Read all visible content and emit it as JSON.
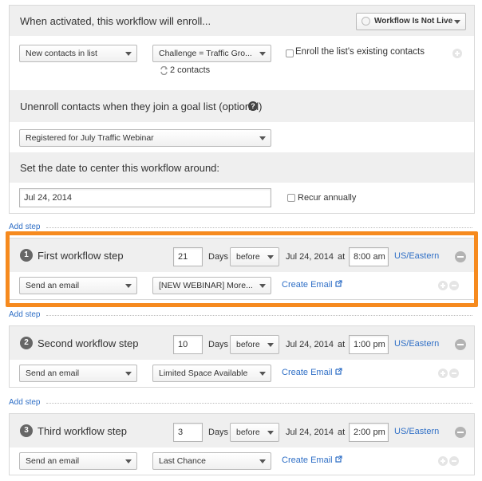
{
  "enroll": {
    "title": "When activated, this workflow will enroll...",
    "status_button": "Workflow Is Not Live",
    "list_type_select": "New contacts in list",
    "list_select": "Challenge = Traffic Gro...",
    "enroll_existing_label": "Enroll the list's existing contacts",
    "contacts_count": "2 contacts"
  },
  "unenroll": {
    "title": "Unenroll contacts when they join a goal list (optional)",
    "goal_list_select": "Registered for July Traffic Webinar"
  },
  "center_date": {
    "title": "Set the date to center this workflow around:",
    "date_value": "Jul 24, 2014",
    "recur_label": "Recur annually"
  },
  "add_step_label": "Add step",
  "common": {
    "days_label": "Days",
    "at_label": "at",
    "timezone": "US/Eastern",
    "create_email": "Create Email",
    "action": "Send an email"
  },
  "steps": [
    {
      "number": "1",
      "title": "First workflow step",
      "days": "21",
      "relation": "before",
      "date": "Jul 24, 2014",
      "time": "8:00 am",
      "email": "[NEW WEBINAR] More..."
    },
    {
      "number": "2",
      "title": "Second workflow step",
      "days": "10",
      "relation": "before",
      "date": "Jul 24, 2014",
      "time": "1:00 pm",
      "email": "Limited Space Available"
    },
    {
      "number": "3",
      "title": "Third workflow step",
      "days": "3",
      "relation": "before",
      "date": "Jul 24, 2014",
      "time": "2:00 pm",
      "email": "Last Chance"
    }
  ],
  "colors": {
    "highlight": "#f68a1e",
    "link": "#2f6fc6",
    "header_bg": "#efefef"
  },
  "icons": [
    "refresh-icon",
    "help-icon",
    "external-link-icon",
    "remove-step-icon",
    "add-icon"
  ]
}
